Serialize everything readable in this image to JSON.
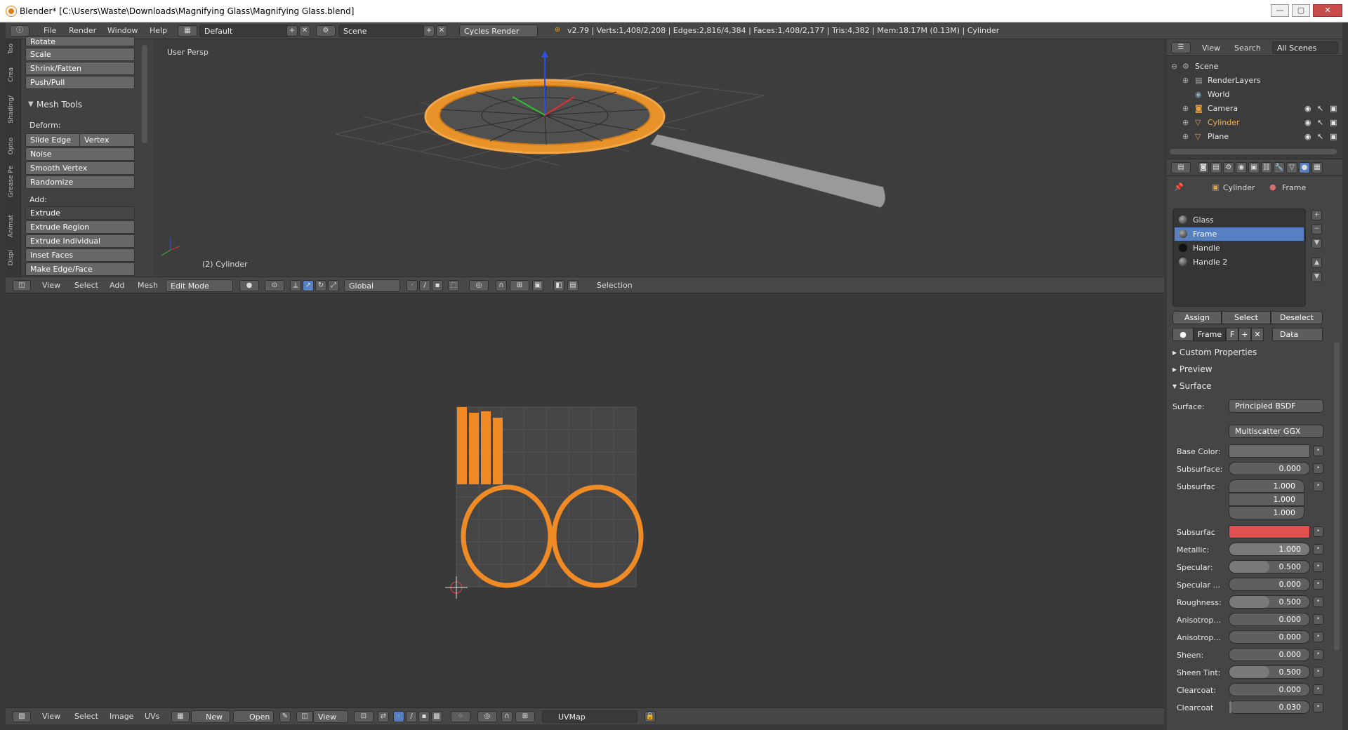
{
  "window": {
    "title": "Blender* [C:\\Users\\Waste\\Downloads\\Magnifying Glass\\Magnifying Glass.blend]",
    "minimize": "—",
    "maximize": "▢",
    "close": "✕"
  },
  "topbar": {
    "menus": [
      "File",
      "Render",
      "Window",
      "Help"
    ],
    "layout": "Default",
    "scene": "Scene",
    "engine": "Cycles Render",
    "stats": "v2.79 | Verts:1,408/2,208 | Edges:2,816/4,384 | Faces:1,408/2,177 | Tris:4,382 | Mem:18.17M (0.13M) | Cylinder"
  },
  "toolshelf": {
    "tabs": [
      "Too",
      "Crea",
      "Shading/",
      "Optio",
      "Grease Pe",
      "Animat",
      "Displ"
    ],
    "top_buttons": [
      "Rotate",
      "Scale",
      "Shrink/Fatten",
      "Push/Pull"
    ],
    "panel_title": "Mesh Tools",
    "deform_label": "Deform:",
    "slide_edge": "Slide Edge",
    "vertex": "Vertex",
    "deform_buttons": [
      "Noise",
      "Smooth Vertex",
      "Randomize"
    ],
    "add_label": "Add:",
    "extrude": "Extrude",
    "add_buttons": [
      "Extrude Region",
      "Extrude Individual",
      "Inset Faces",
      "Make Edge/Face"
    ]
  },
  "viewport": {
    "label": "User Persp",
    "object_label": "(2) Cylinder",
    "header": {
      "menus": [
        "View",
        "Select",
        "Add",
        "Mesh"
      ],
      "mode": "Edit Mode",
      "orientation": "Global",
      "selection": "Selection"
    }
  },
  "uv_header": {
    "menus": [
      "View",
      "Select",
      "Image",
      "UVs"
    ],
    "new": "New",
    "open": "Open",
    "view": "View",
    "uvmap": "UVMap"
  },
  "outliner": {
    "menus": [
      "View",
      "Search"
    ],
    "scope": "All Scenes",
    "items": [
      "Scene",
      "RenderLayers",
      "World",
      "Camera",
      "Cylinder",
      "Plane"
    ]
  },
  "properties": {
    "breadcrumb_object": "Cylinder",
    "breadcrumb_material": "Frame",
    "materials": [
      "Glass",
      "Frame",
      "Handle",
      "Handle 2"
    ],
    "selected_material": "Frame",
    "assign": "Assign",
    "select": "Select",
    "deselect": "Deselect",
    "material_name": "Frame",
    "fake_user": "F",
    "link": "Data",
    "sections": [
      "Custom Properties",
      "Preview",
      "Surface"
    ],
    "surface_label": "Surface:",
    "surface_value": "Principled BSDF",
    "distribution": "Multiscatter GGX",
    "base_color_label": "Base Color:",
    "subsurface_label": "Subsurface:",
    "subsurface_value": "0.000",
    "subsurface_radius_label": "Subsurfac",
    "radius": [
      "1.000",
      "1.000",
      "1.000"
    ],
    "subsurface_color_label": "Subsurfac",
    "subsurface_color": "#e05050",
    "params": [
      {
        "label": "Metallic:",
        "value": "1.000",
        "fraction": 1.0
      },
      {
        "label": "Specular:",
        "value": "0.500",
        "fraction": 0.5
      },
      {
        "label": "Specular ...",
        "value": "0.000",
        "fraction": 0.0
      },
      {
        "label": "Roughness:",
        "value": "0.500",
        "fraction": 0.5
      },
      {
        "label": "Anisotrop...",
        "value": "0.000",
        "fraction": 0.0
      },
      {
        "label": "Anisotrop...",
        "value": "0.000",
        "fraction": 0.0
      },
      {
        "label": "Sheen:",
        "value": "0.000",
        "fraction": 0.0
      },
      {
        "label": "Sheen Tint:",
        "value": "0.500",
        "fraction": 0.5
      },
      {
        "label": "Clearcoat:",
        "value": "0.000",
        "fraction": 0.0
      },
      {
        "label": "Clearcoat",
        "value": "0.030",
        "fraction": 0.03
      }
    ]
  }
}
